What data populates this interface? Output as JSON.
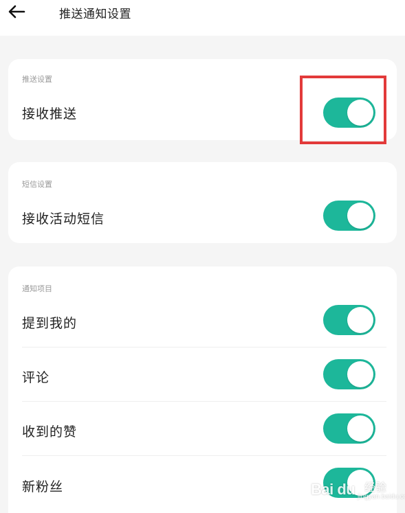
{
  "header": {
    "title": "推送通知设置",
    "back_icon": "arrow-left-icon"
  },
  "sections": {
    "push": {
      "label": "推送设置",
      "rows": [
        {
          "label": "接收推送",
          "on": true
        }
      ]
    },
    "sms": {
      "label": "短信设置",
      "rows": [
        {
          "label": "接收活动短信",
          "on": true
        }
      ]
    },
    "notify": {
      "label": "通知项目",
      "rows": [
        {
          "label": "提到我的",
          "on": true
        },
        {
          "label": "评论",
          "on": true
        },
        {
          "label": "收到的赞",
          "on": true
        },
        {
          "label": "新粉丝",
          "on": true
        }
      ]
    }
  },
  "watermark": {
    "logo": "Bai du",
    "sub": "经验",
    "url": "jingyan.baidu.com"
  },
  "colors": {
    "toggle_on": "#1db79a",
    "highlight": "#e23a3a",
    "background": "#f5f5f5",
    "card": "#ffffff"
  }
}
